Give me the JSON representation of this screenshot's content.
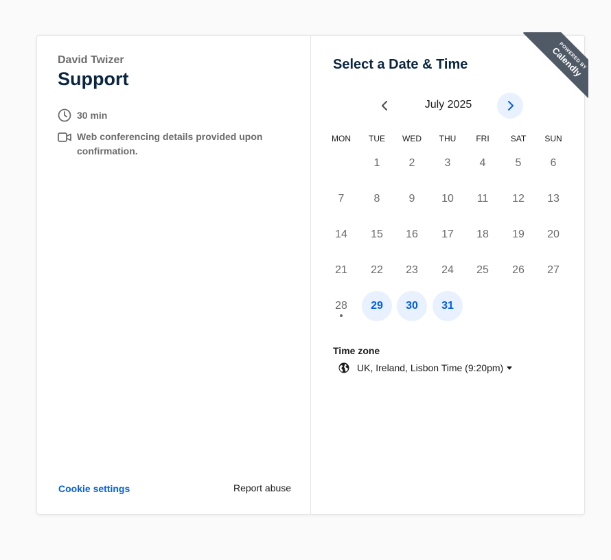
{
  "event": {
    "host": "David Twizer",
    "title": "Support",
    "duration": "30 min",
    "location_note": "Web conferencing details provided upon confirmation."
  },
  "footer": {
    "cookie_label": "Cookie settings",
    "report_label": "Report abuse"
  },
  "scheduler": {
    "title": "Select a Date & Time",
    "month_label": "July 2025",
    "weekdays": [
      "MON",
      "TUE",
      "WED",
      "THU",
      "FRI",
      "SAT",
      "SUN"
    ],
    "days": [
      {
        "label": "1",
        "weekday": 1,
        "week": 0,
        "status": "unavailable"
      },
      {
        "label": "2",
        "weekday": 2,
        "week": 0,
        "status": "unavailable"
      },
      {
        "label": "3",
        "weekday": 3,
        "week": 0,
        "status": "unavailable"
      },
      {
        "label": "4",
        "weekday": 4,
        "week": 0,
        "status": "unavailable"
      },
      {
        "label": "5",
        "weekday": 5,
        "week": 0,
        "status": "unavailable"
      },
      {
        "label": "6",
        "weekday": 6,
        "week": 0,
        "status": "unavailable"
      },
      {
        "label": "7",
        "weekday": 0,
        "week": 1,
        "status": "unavailable"
      },
      {
        "label": "8",
        "weekday": 1,
        "week": 1,
        "status": "unavailable"
      },
      {
        "label": "9",
        "weekday": 2,
        "week": 1,
        "status": "unavailable"
      },
      {
        "label": "10",
        "weekday": 3,
        "week": 1,
        "status": "unavailable"
      },
      {
        "label": "11",
        "weekday": 4,
        "week": 1,
        "status": "unavailable"
      },
      {
        "label": "12",
        "weekday": 5,
        "week": 1,
        "status": "unavailable"
      },
      {
        "label": "13",
        "weekday": 6,
        "week": 1,
        "status": "unavailable"
      },
      {
        "label": "14",
        "weekday": 0,
        "week": 2,
        "status": "unavailable"
      },
      {
        "label": "15",
        "weekday": 1,
        "week": 2,
        "status": "unavailable"
      },
      {
        "label": "16",
        "weekday": 2,
        "week": 2,
        "status": "unavailable"
      },
      {
        "label": "17",
        "weekday": 3,
        "week": 2,
        "status": "unavailable"
      },
      {
        "label": "18",
        "weekday": 4,
        "week": 2,
        "status": "unavailable"
      },
      {
        "label": "19",
        "weekday": 5,
        "week": 2,
        "status": "unavailable"
      },
      {
        "label": "20",
        "weekday": 6,
        "week": 2,
        "status": "unavailable"
      },
      {
        "label": "21",
        "weekday": 0,
        "week": 3,
        "status": "unavailable"
      },
      {
        "label": "22",
        "weekday": 1,
        "week": 3,
        "status": "unavailable"
      },
      {
        "label": "23",
        "weekday": 2,
        "week": 3,
        "status": "unavailable"
      },
      {
        "label": "24",
        "weekday": 3,
        "week": 3,
        "status": "unavailable"
      },
      {
        "label": "25",
        "weekday": 4,
        "week": 3,
        "status": "unavailable"
      },
      {
        "label": "26",
        "weekday": 5,
        "week": 3,
        "status": "unavailable"
      },
      {
        "label": "27",
        "weekday": 6,
        "week": 3,
        "status": "unavailable"
      },
      {
        "label": "28",
        "weekday": 0,
        "week": 4,
        "status": "today"
      },
      {
        "label": "29",
        "weekday": 1,
        "week": 4,
        "status": "available"
      },
      {
        "label": "30",
        "weekday": 2,
        "week": 4,
        "status": "available"
      },
      {
        "label": "31",
        "weekday": 3,
        "week": 4,
        "status": "available"
      }
    ],
    "timezone_label": "Time zone",
    "timezone_value": "UK, Ireland, Lisbon Time (9:20pm)"
  },
  "badge": {
    "line1": "POWERED BY",
    "brand": "Calendly"
  },
  "colors": {
    "accent": "#0060e6",
    "available_bg": "#e8f1fd",
    "heading": "#0a2540",
    "ribbon": "#505a66"
  },
  "icons": {
    "duration": "clock-icon",
    "location": "video-camera-icon",
    "prev": "chevron-left-icon",
    "next": "chevron-right-icon",
    "timezone": "globe-icon"
  }
}
